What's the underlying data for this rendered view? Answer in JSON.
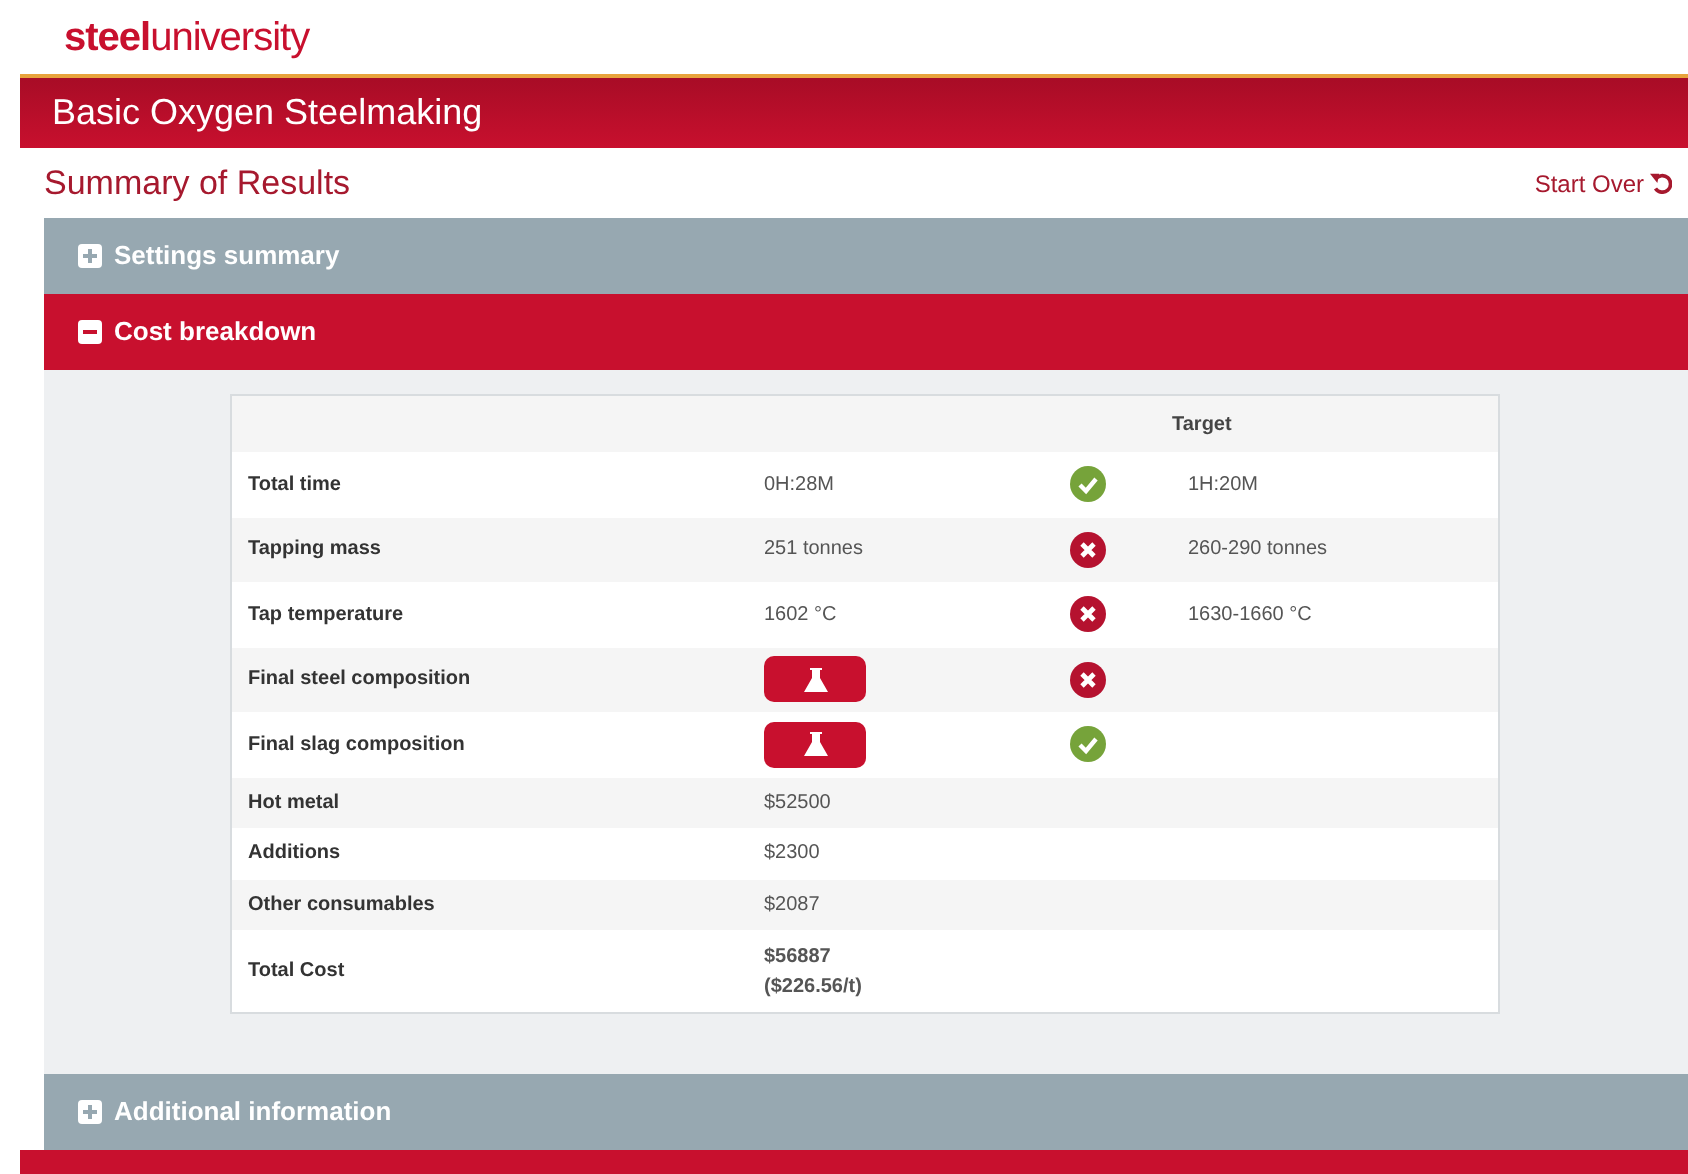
{
  "logo": "**steel**university",
  "app_title": "Basic Oxygen Steelmaking",
  "page_title": "Summary of Results",
  "start_over": "Start Over",
  "sections": [
    {
      "title": "Settings summary",
      "expanded": false
    },
    {
      "title": "Cost breakdown",
      "expanded": true
    },
    {
      "title": "Additional information",
      "expanded": false
    }
  ],
  "table": {
    "columns": [
      "Target"
    ],
    "rows": [
      {
        "label": "Total time",
        "kind": "text",
        "value": [
          "0H:28M"
        ],
        "passed": true,
        "target": "1H:20M"
      },
      {
        "label": "Tapping mass",
        "kind": "text",
        "value": [
          "251 tonnes"
        ],
        "passed": false,
        "target": "260-290 tonnes"
      },
      {
        "label": "Tap temperature",
        "kind": "text",
        "value": [
          "1602 °C"
        ],
        "passed": false,
        "target": "1630-1660 °C"
      },
      {
        "label": "Final steel composition",
        "kind": "flask",
        "passed": false
      },
      {
        "label": "Final slag composition",
        "kind": "flask",
        "passed": true
      },
      {
        "label": "Hot metal",
        "kind": "text",
        "value": [
          "$52500"
        ]
      },
      {
        "label": "Additions",
        "kind": "text",
        "value": [
          "$2300"
        ]
      },
      {
        "label": "Other consumables",
        "kind": "text",
        "value": [
          "$2087"
        ]
      },
      {
        "label": "Total Cost",
        "kind": "text",
        "value": [
          "$56887",
          "($226.56/t)"
        ]
      }
    ]
  }
}
